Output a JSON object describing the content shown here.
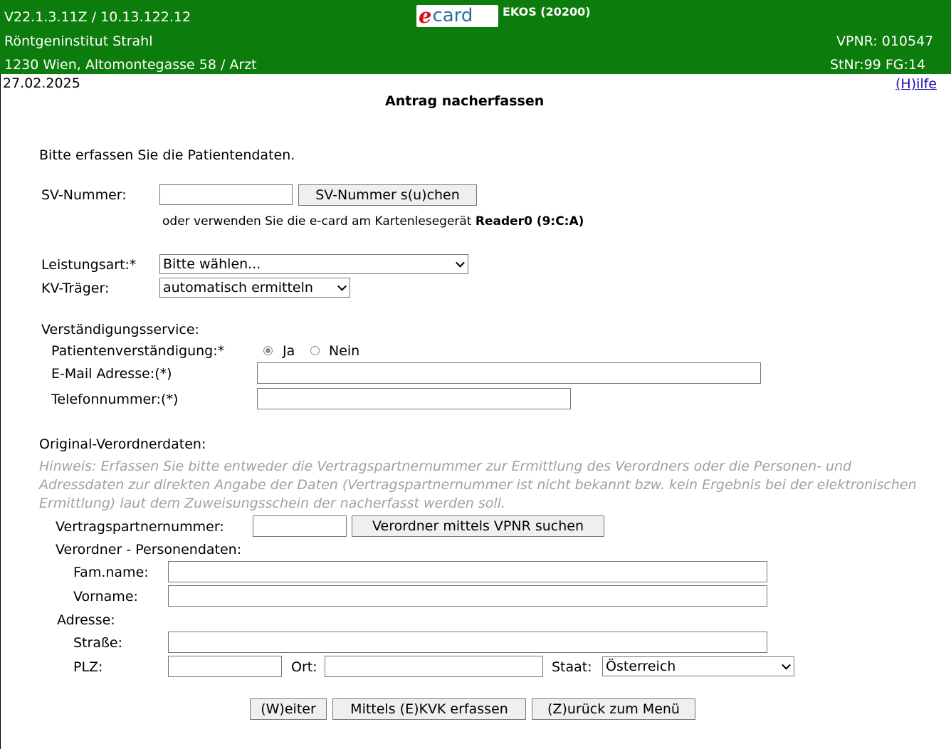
{
  "header": {
    "version_ip": "V22.1.3.11Z / 10.13.122.12",
    "institute": "Röntgeninstitut Strahl",
    "address_role": "1230 Wien, Altomontegasse 58 / Arzt",
    "logo_e": "e",
    "logo_card": "card",
    "ekos": "EKOS (20200)",
    "vpnr": "VPNR: 010547",
    "stnr_fg": "StNr:99 FG:14"
  },
  "date": "27.02.2025",
  "help_link": "(H)ilfe",
  "page_title": "Antrag nacherfassen",
  "intro": "Bitte erfassen Sie die Patientendaten.",
  "sv": {
    "label": "SV-Nummer:",
    "value": "",
    "search_button": "SV-Nummer s(u)chen",
    "card_hint_prefix": "oder verwenden Sie die e-card am Kartenlesegerät",
    "reader": "Reader0 (9:C:A)"
  },
  "leistungsart": {
    "label": "Leistungsart:*",
    "selected": "Bitte wählen..."
  },
  "kv_traeger": {
    "label": "KV-Träger:",
    "selected": "automatisch ermitteln"
  },
  "verstaendigung": {
    "section_label": "Verständigungsservice:",
    "patient_label": "Patientenverständigung:*",
    "option_yes": "Ja",
    "option_no": "Nein",
    "selected": "Ja",
    "email_label": "E-Mail Adresse:(*)",
    "email_value": "",
    "phone_label": "Telefonnummer:(*)",
    "phone_value": ""
  },
  "verordner": {
    "section_label": "Original-Verordnerdaten:",
    "hint": "Hinweis: Erfassen Sie bitte entweder die Vertragspartnernummer zur Ermittlung des Verordners oder die Personen- und Adressdaten zur direkten Angabe der Daten (Vertragspartnernummer ist nicht bekannt bzw. kein Ergebnis bei der elektronischen Ermittlung) laut dem Zuweisungsschein der nacherfasst werden soll.",
    "vpnr_label": "Vertragspartnernummer:",
    "vpnr_value": "",
    "vpnr_button": "Verordner mittels VPNR suchen",
    "person_label": "Verordner - Personendaten:",
    "famname_label": "Fam.name:",
    "famname_value": "",
    "vorname_label": "Vorname:",
    "vorname_value": "",
    "address_label": "Adresse:",
    "strasse_label": "Straße:",
    "strasse_value": "",
    "plz_label": "PLZ:",
    "plz_value": "",
    "ort_label": "Ort:",
    "ort_value": "",
    "staat_label": "Staat:",
    "staat_selected": "Österreich"
  },
  "actions": {
    "weiter": "(W)eiter",
    "ekvk": "Mittels (E)KVK erfassen",
    "zurueck": "(Z)urück zum Menü"
  },
  "colors": {
    "header_bg": "#0c7c0c",
    "hint_text": "#a0a0a0",
    "link": "#1a0dab"
  }
}
